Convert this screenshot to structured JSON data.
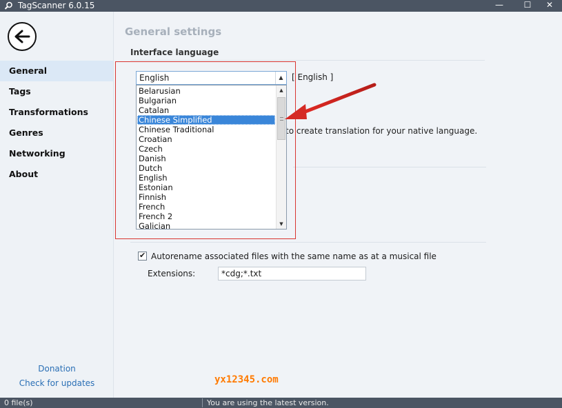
{
  "window": {
    "title": "TagScanner 6.0.15",
    "minimize": "—",
    "maximize": "☐",
    "close": "✕"
  },
  "sidebar": {
    "items": [
      {
        "label": "General"
      },
      {
        "label": "Tags"
      },
      {
        "label": "Transformations"
      },
      {
        "label": "Genres"
      },
      {
        "label": "Networking"
      },
      {
        "label": "About"
      }
    ],
    "active": "General",
    "donation": "Donation",
    "updates": "Check for updates"
  },
  "main": {
    "title": "General settings",
    "interface_language": {
      "section": "Interface language",
      "selected": "English",
      "code_label": "[ English ]",
      "options": [
        "Belarusian",
        "Bulgarian",
        "Catalan",
        "Chinese Simplified",
        "Chinese Traditional",
        "Croatian",
        "Czech",
        "Danish",
        "Dutch",
        "English",
        "Estonian",
        "Finnish",
        "French",
        "French 2",
        "Galician"
      ],
      "highlighted": "Chinese Simplified",
      "hint_fragment": "to create translation for your native language."
    },
    "autorename": {
      "checked": true,
      "label": "Autorename associated files with the same name as at a musical file",
      "extensions_label": "Extensions:",
      "extensions_value": "*cdg;*.txt"
    }
  },
  "watermark": "yx12345.com",
  "status": {
    "files": "0 file(s)",
    "message": "You are using the latest version."
  },
  "colors": {
    "annotation": "#d9342f",
    "selection": "#3a86d9",
    "titlebar": "#4b5563"
  }
}
